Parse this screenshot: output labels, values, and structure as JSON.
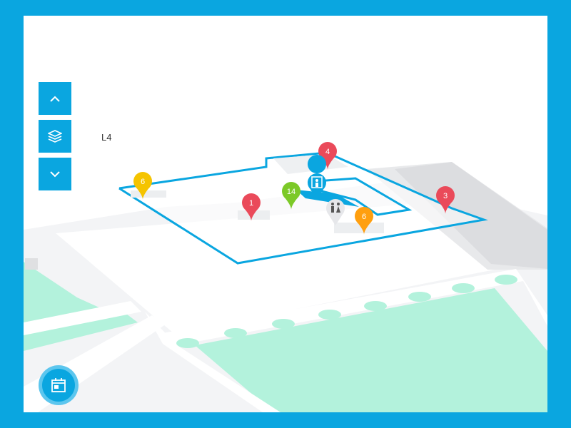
{
  "map": {
    "floor_label": "L4",
    "markers": [
      {
        "label": "4",
        "color": "#ea4a5a"
      },
      {
        "label": "6",
        "color": "#f5c400"
      },
      {
        "label": "14",
        "color": "#7cc928"
      },
      {
        "label": "1",
        "color": "#ea4a5a"
      },
      {
        "label": "6",
        "color": "#ff9f0f"
      },
      {
        "label": "3",
        "color": "#ea4a5a"
      }
    ],
    "icons": [
      "elevator-icon",
      "restroom-icon"
    ]
  },
  "controls": {
    "up_icon": "chevron-up-icon",
    "layers_icon": "layers-icon",
    "down_icon": "chevron-down-icon",
    "calendar_icon": "calendar-icon"
  },
  "colors": {
    "accent": "#0aa6e0",
    "park": "#b3f2dc",
    "road": "#f0f1f3"
  }
}
